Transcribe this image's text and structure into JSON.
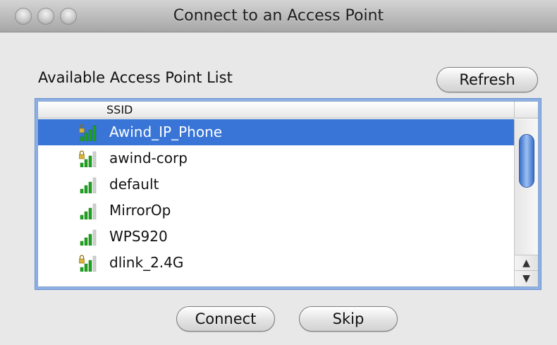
{
  "window": {
    "title": "Connect to an Access Point"
  },
  "panel": {
    "section_label": "Available Access Point List",
    "refresh_label": "Refresh"
  },
  "list": {
    "column_header": "SSID",
    "rows": [
      {
        "ssid": "Awind_IP_Phone",
        "locked": true,
        "selected": true,
        "signal_bars": 4
      },
      {
        "ssid": "awind-corp",
        "locked": true,
        "selected": false,
        "signal_bars": 3
      },
      {
        "ssid": "default",
        "locked": false,
        "selected": false,
        "signal_bars": 3
      },
      {
        "ssid": "MirrorOp",
        "locked": false,
        "selected": false,
        "signal_bars": 3
      },
      {
        "ssid": "WPS920",
        "locked": false,
        "selected": false,
        "signal_bars": 3
      },
      {
        "ssid": "dlink_2.4G",
        "locked": true,
        "selected": false,
        "signal_bars": 3
      }
    ],
    "scroll_up_glyph": "▲",
    "scroll_down_glyph": "▼"
  },
  "footer": {
    "connect_label": "Connect",
    "skip_label": "Skip"
  },
  "colors": {
    "selection": "#3875d7",
    "signal_on": "#1fa21f",
    "signal_off": "#d0d0d0",
    "lock": "#d8b43a"
  },
  "icons": {
    "signal": "wifi-signal-icon",
    "lock": "lock-icon"
  }
}
